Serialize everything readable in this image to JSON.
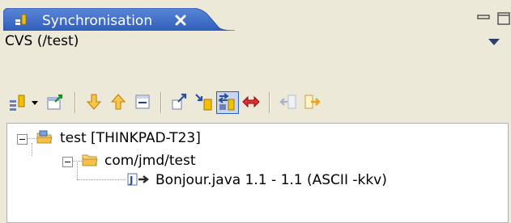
{
  "tab": {
    "title": "Synchronisation",
    "close": "✕"
  },
  "header": {
    "label": "CVS (/test)"
  },
  "tree": {
    "root": {
      "label": "test  [THINKPAD-T23]"
    },
    "folder": {
      "label": "com/jmd/test"
    },
    "file": {
      "label": "Bonjour.java  1.1 - 1.1  (ASCII -kkv)"
    }
  },
  "colors": {
    "tab_active": "#3c6bc7",
    "selection_blue": "#2b5fb4"
  },
  "icons": [
    "sync-icon",
    "dropdown-arrow-icon",
    "commit-icon",
    "next-change-icon",
    "previous-change-icon",
    "collapse-all-icon",
    "outgoing-mode-icon",
    "incoming-mode-icon",
    "incoming-outgoing-mode-icon",
    "conflicts-mode-icon",
    "remove-icon",
    "pin-icon"
  ]
}
